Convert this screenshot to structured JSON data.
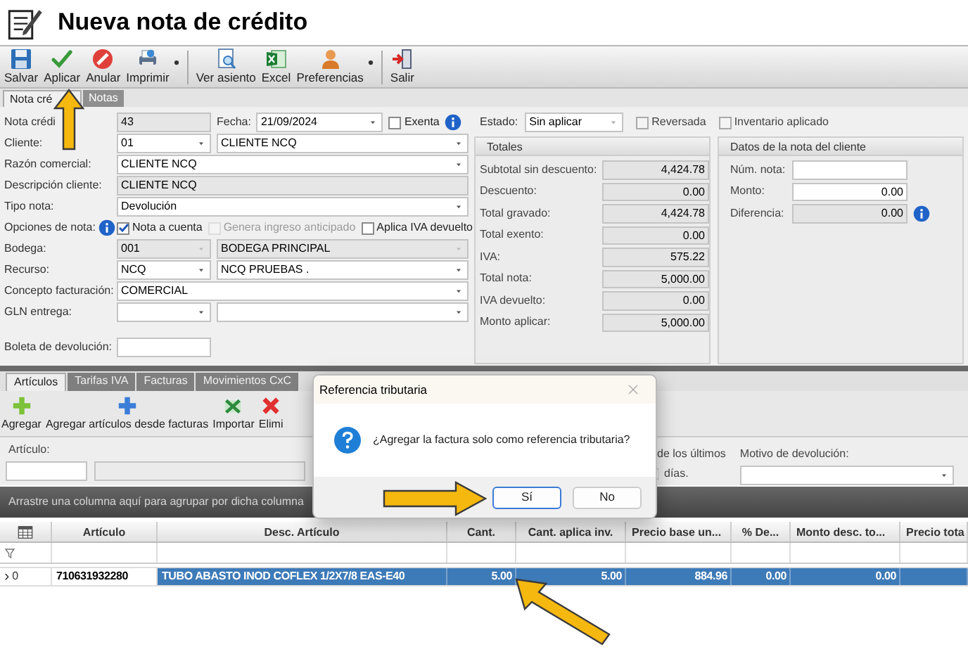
{
  "window": {
    "title": "Nueva nota de crédito"
  },
  "toolbar": [
    [
      {
        "kind": "save",
        "label": "Salvar",
        "menu": false
      },
      {
        "kind": "apply",
        "label": "Aplicar",
        "menu": false
      },
      {
        "kind": "void",
        "label": "Anular",
        "menu": false
      },
      {
        "kind": "print",
        "label": "Imprimir",
        "menu": true
      }
    ],
    [
      {
        "kind": "entry",
        "label": "Ver asiento",
        "menu": false
      },
      {
        "kind": "excel",
        "label": "Excel",
        "menu": false
      },
      {
        "kind": "preferences",
        "label": "Preferencias",
        "menu": true
      }
    ],
    [
      {
        "kind": "exit",
        "label": "Salir",
        "menu": false
      }
    ]
  ],
  "form_tabs": [
    {
      "label": "Nota cré",
      "selected": true
    },
    {
      "label": "Notas",
      "selected": false
    }
  ],
  "note_form": {
    "rows": [
      {
        "label": "Nota crédi",
        "controls": [
          {
            "kind": "short-field",
            "value": "43",
            "readonly": true
          },
          {
            "kind": "caption",
            "value": "Fecha:"
          },
          {
            "kind": "date",
            "value": "21/09/2024",
            "readonly": false
          },
          {
            "kind": "checkbox",
            "value": "Exenta",
            "checked": false,
            "disabled": false
          },
          {
            "kind": "info"
          }
        ]
      },
      {
        "label": "Cliente:",
        "controls": [
          {
            "kind": "short-dropdown",
            "value": "01",
            "readonly": false
          },
          {
            "kind": "wide-dropdown",
            "value": "CLIENTE NCQ",
            "readonly": false
          }
        ]
      },
      {
        "label": "Razón comercial:",
        "controls": [
          {
            "kind": "full-dropdown",
            "value": "CLIENTE NCQ",
            "readonly": false
          }
        ]
      },
      {
        "label": "Descripción cliente:",
        "controls": [
          {
            "kind": "full-field",
            "value": "CLIENTE NCQ",
            "readonly": true
          }
        ]
      },
      {
        "label": "Tipo nota:",
        "controls": [
          {
            "kind": "full-dropdown",
            "value": "Devolución",
            "readonly": false
          }
        ]
      },
      {
        "label": "Opciones de nota:",
        "controls": [
          {
            "kind": "info"
          },
          {
            "kind": "checkbox",
            "value": "Nota a cuenta",
            "checked": true,
            "disabled": false
          },
          {
            "kind": "checkbox",
            "value": "Genera ingreso anticipado",
            "checked": false,
            "disabled": true
          },
          {
            "kind": "checkbox",
            "value": "Aplica IVA devuelto",
            "checked": false,
            "disabled": false
          }
        ]
      },
      {
        "label": "Bodega:",
        "controls": [
          {
            "kind": "short-dropdown",
            "value": "001",
            "readonly": true
          },
          {
            "kind": "wide-dropdown",
            "value": "BODEGA PRINCIPAL",
            "readonly": true
          }
        ]
      },
      {
        "label": "Recurso:",
        "controls": [
          {
            "kind": "short-dropdown",
            "value": "NCQ",
            "readonly": false
          },
          {
            "kind": "wide-dropdown",
            "value": "NCQ PRUEBAS .",
            "readonly": false
          }
        ]
      },
      {
        "label": "Concepto facturación:",
        "controls": [
          {
            "kind": "full-dropdown",
            "value": "COMERCIAL",
            "readonly": false
          }
        ]
      },
      {
        "label": "GLN entrega:",
        "controls": [
          {
            "kind": "short-dropdown",
            "readonly": false
          },
          {
            "kind": "wide-dropdown",
            "readonly": false
          }
        ]
      }
    ],
    "return_slip": {
      "label": "Boleta de devolución:"
    }
  },
  "status": {
    "label": "Estado:",
    "value": "Sin aplicar",
    "checks": [
      {
        "label": "Reversada",
        "checked": false
      },
      {
        "label": "Inventario aplicado",
        "checked": false
      }
    ]
  },
  "totals": {
    "title": "Totales",
    "rows": [
      {
        "label": "Subtotal sin descuento:",
        "value": "4,424.78"
      },
      {
        "label": "Descuento:",
        "value": "0.00"
      },
      {
        "label": "Total gravado:",
        "value": "4,424.78"
      },
      {
        "label": "Total exento:",
        "value": "0.00"
      },
      {
        "label": "IVA:",
        "value": "575.22"
      },
      {
        "label": "Total nota:",
        "value": "5,000.00"
      },
      {
        "label": "IVA devuelto:",
        "value": "0.00"
      },
      {
        "label": "Monto aplicar:",
        "value": "5,000.00"
      }
    ]
  },
  "client_note": {
    "title": "Datos de la nota del cliente",
    "rows": [
      {
        "label": "Núm. nota:",
        "readonly": false,
        "info": false
      },
      {
        "label": "Monto:",
        "value": "0.00",
        "readonly": false,
        "info": false
      },
      {
        "label": "Diferencia:",
        "value": "0.00",
        "readonly": true,
        "info": true
      }
    ]
  },
  "detail_tabs": [
    {
      "label": "Artículos",
      "selected": true
    },
    {
      "label": "Tarifas IVA",
      "selected": false
    },
    {
      "label": "Facturas",
      "selected": false
    },
    {
      "label": "Movimientos CxC",
      "selected": false
    }
  ],
  "detail_toolbar": [
    {
      "kind": "add",
      "label": "Agregar"
    },
    {
      "kind": "add-from",
      "label": "Agregar artículos desde facturas"
    },
    {
      "kind": "import",
      "label": "Importar"
    },
    {
      "kind": "delete",
      "label": "Elimi"
    }
  ],
  "article_filter": {
    "label": "Artículo:"
  },
  "days_filter": {
    "before": "de los últimos",
    "after": "días."
  },
  "return_reason": {
    "label": "Motivo de devolución:"
  },
  "group_hint": "Arrastre una columna aquí para agrupar por dicha columna",
  "grid": {
    "columns": [
      "Artículo",
      "Desc. Artículo",
      "Cant.",
      "Cant. aplica inv.",
      "Precio base un...",
      "% De...",
      "Monto desc. to...",
      "Precio tota"
    ],
    "rows": [
      {
        "indicator": "›",
        "number": "0",
        "selected": true,
        "cells": [
          "710631932280",
          "TUBO ABASTO INOD COFLEX 1/2X7/8 EAS-E40",
          "5.00",
          "5.00",
          "884.96",
          "0.00",
          "0.00"
        ]
      }
    ]
  },
  "dialog": {
    "title": "Referencia tributaria",
    "message": "¿Agregar la factura solo como referencia tributaria?",
    "buttons": [
      {
        "label": "Sí",
        "focused": true
      },
      {
        "label": "No",
        "focused": false
      }
    ]
  }
}
